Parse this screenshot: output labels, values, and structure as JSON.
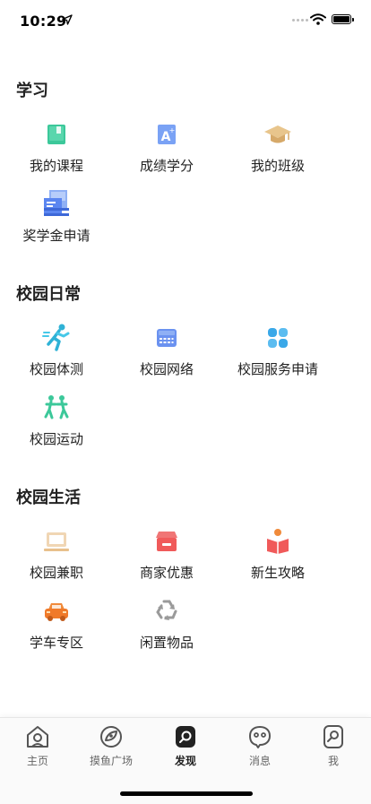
{
  "status_bar": {
    "time": "10:29"
  },
  "sections": {
    "study": {
      "title": "学习",
      "items": [
        {
          "label": "我的课程",
          "icon": "course-book-icon"
        },
        {
          "label": "成绩学分",
          "icon": "grade-a-plus-icon"
        },
        {
          "label": "我的班级",
          "icon": "graduation-cap-icon"
        },
        {
          "label": "奖学金申请",
          "icon": "scholarship-certificate-icon"
        }
      ]
    },
    "campus_daily": {
      "title": "校园日常",
      "items": [
        {
          "label": "校园体测",
          "icon": "running-person-icon"
        },
        {
          "label": "校园网络",
          "icon": "network-device-icon"
        },
        {
          "label": "校园服务申请",
          "icon": "clover-grid-icon"
        },
        {
          "label": "校园运动",
          "icon": "sports-people-icon"
        }
      ]
    },
    "campus_life": {
      "title": "校园生活",
      "items": [
        {
          "label": "校园兼职",
          "icon": "laptop-icon"
        },
        {
          "label": "商家优惠",
          "icon": "shop-store-icon"
        },
        {
          "label": "新生攻略",
          "icon": "reading-student-icon"
        },
        {
          "label": "学车专区",
          "icon": "car-icon"
        },
        {
          "label": "闲置物品",
          "icon": "recycle-icon"
        }
      ]
    }
  },
  "tab_bar": {
    "tabs": [
      {
        "label": "主页",
        "icon": "home-icon"
      },
      {
        "label": "摸鱼广场",
        "icon": "eye-circle-icon"
      },
      {
        "label": "发现",
        "icon": "discover-icon",
        "active": true
      },
      {
        "label": "消息",
        "icon": "message-bubble-icon"
      },
      {
        "label": "我",
        "icon": "profile-icon"
      }
    ]
  },
  "colors": {
    "accent_green": "#3cc89a",
    "accent_blue": "#5b86f0",
    "accent_red": "#f05a5a",
    "accent_orange": "#f08a3a",
    "tab_active": "#222222",
    "tab_inactive": "#666666"
  }
}
